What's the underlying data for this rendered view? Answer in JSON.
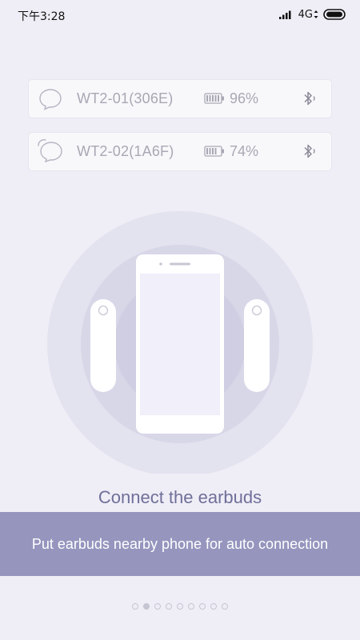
{
  "status_bar": {
    "time": "下午3:28",
    "network": "4G",
    "icons": [
      "signal-icon",
      "data-arrows-icon",
      "battery-icon"
    ]
  },
  "devices": [
    {
      "name": "WT2-01(306E)",
      "battery": "96%",
      "battery_level": 0.96,
      "icon": "earbud-right-icon",
      "status_icon": "bluetooth-icon"
    },
    {
      "name": "WT2-02(1A6F)",
      "battery": "74%",
      "battery_level": 0.74,
      "icon": "earbud-left-icon",
      "status_icon": "bluetooth-icon"
    }
  ],
  "illustration": {
    "icons": [
      "phone-icon",
      "earbud-left-icon",
      "earbud-right-icon"
    ]
  },
  "title": "Connect the earbuds",
  "banner_text": "Put earbuds nearby phone for auto connection",
  "pagination": {
    "total": 9,
    "active_index": 1
  },
  "colors": {
    "background": "#efeef6",
    "accent": "#9595be",
    "title": "#6f6f9a",
    "muted_text": "#a8a8b4"
  }
}
